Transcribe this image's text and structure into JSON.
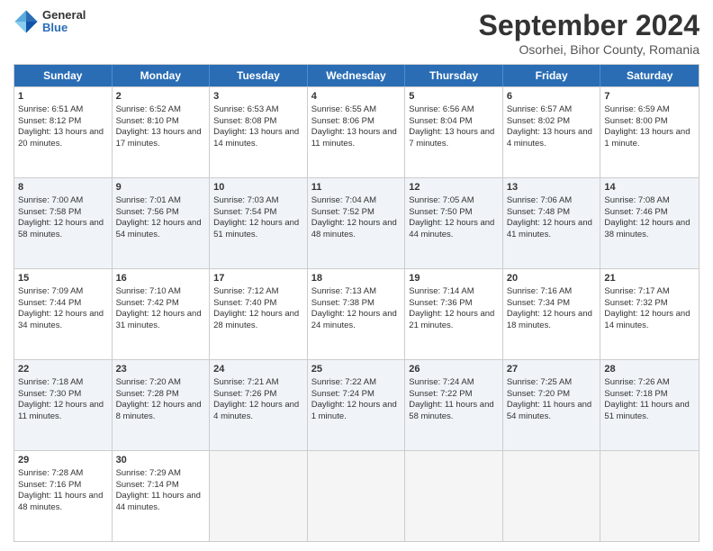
{
  "logo": {
    "general": "General",
    "blue": "Blue"
  },
  "title": "September 2024",
  "location": "Osorhei, Bihor County, Romania",
  "headers": [
    "Sunday",
    "Monday",
    "Tuesday",
    "Wednesday",
    "Thursday",
    "Friday",
    "Saturday"
  ],
  "rows": [
    [
      {
        "day": "1",
        "sunrise": "Sunrise: 6:51 AM",
        "sunset": "Sunset: 8:12 PM",
        "daylight": "Daylight: 13 hours and 20 minutes."
      },
      {
        "day": "2",
        "sunrise": "Sunrise: 6:52 AM",
        "sunset": "Sunset: 8:10 PM",
        "daylight": "Daylight: 13 hours and 17 minutes."
      },
      {
        "day": "3",
        "sunrise": "Sunrise: 6:53 AM",
        "sunset": "Sunset: 8:08 PM",
        "daylight": "Daylight: 13 hours and 14 minutes."
      },
      {
        "day": "4",
        "sunrise": "Sunrise: 6:55 AM",
        "sunset": "Sunset: 8:06 PM",
        "daylight": "Daylight: 13 hours and 11 minutes."
      },
      {
        "day": "5",
        "sunrise": "Sunrise: 6:56 AM",
        "sunset": "Sunset: 8:04 PM",
        "daylight": "Daylight: 13 hours and 7 minutes."
      },
      {
        "day": "6",
        "sunrise": "Sunrise: 6:57 AM",
        "sunset": "Sunset: 8:02 PM",
        "daylight": "Daylight: 13 hours and 4 minutes."
      },
      {
        "day": "7",
        "sunrise": "Sunrise: 6:59 AM",
        "sunset": "Sunset: 8:00 PM",
        "daylight": "Daylight: 13 hours and 1 minute."
      }
    ],
    [
      {
        "day": "8",
        "sunrise": "Sunrise: 7:00 AM",
        "sunset": "Sunset: 7:58 PM",
        "daylight": "Daylight: 12 hours and 58 minutes."
      },
      {
        "day": "9",
        "sunrise": "Sunrise: 7:01 AM",
        "sunset": "Sunset: 7:56 PM",
        "daylight": "Daylight: 12 hours and 54 minutes."
      },
      {
        "day": "10",
        "sunrise": "Sunrise: 7:03 AM",
        "sunset": "Sunset: 7:54 PM",
        "daylight": "Daylight: 12 hours and 51 minutes."
      },
      {
        "day": "11",
        "sunrise": "Sunrise: 7:04 AM",
        "sunset": "Sunset: 7:52 PM",
        "daylight": "Daylight: 12 hours and 48 minutes."
      },
      {
        "day": "12",
        "sunrise": "Sunrise: 7:05 AM",
        "sunset": "Sunset: 7:50 PM",
        "daylight": "Daylight: 12 hours and 44 minutes."
      },
      {
        "day": "13",
        "sunrise": "Sunrise: 7:06 AM",
        "sunset": "Sunset: 7:48 PM",
        "daylight": "Daylight: 12 hours and 41 minutes."
      },
      {
        "day": "14",
        "sunrise": "Sunrise: 7:08 AM",
        "sunset": "Sunset: 7:46 PM",
        "daylight": "Daylight: 12 hours and 38 minutes."
      }
    ],
    [
      {
        "day": "15",
        "sunrise": "Sunrise: 7:09 AM",
        "sunset": "Sunset: 7:44 PM",
        "daylight": "Daylight: 12 hours and 34 minutes."
      },
      {
        "day": "16",
        "sunrise": "Sunrise: 7:10 AM",
        "sunset": "Sunset: 7:42 PM",
        "daylight": "Daylight: 12 hours and 31 minutes."
      },
      {
        "day": "17",
        "sunrise": "Sunrise: 7:12 AM",
        "sunset": "Sunset: 7:40 PM",
        "daylight": "Daylight: 12 hours and 28 minutes."
      },
      {
        "day": "18",
        "sunrise": "Sunrise: 7:13 AM",
        "sunset": "Sunset: 7:38 PM",
        "daylight": "Daylight: 12 hours and 24 minutes."
      },
      {
        "day": "19",
        "sunrise": "Sunrise: 7:14 AM",
        "sunset": "Sunset: 7:36 PM",
        "daylight": "Daylight: 12 hours and 21 minutes."
      },
      {
        "day": "20",
        "sunrise": "Sunrise: 7:16 AM",
        "sunset": "Sunset: 7:34 PM",
        "daylight": "Daylight: 12 hours and 18 minutes."
      },
      {
        "day": "21",
        "sunrise": "Sunrise: 7:17 AM",
        "sunset": "Sunset: 7:32 PM",
        "daylight": "Daylight: 12 hours and 14 minutes."
      }
    ],
    [
      {
        "day": "22",
        "sunrise": "Sunrise: 7:18 AM",
        "sunset": "Sunset: 7:30 PM",
        "daylight": "Daylight: 12 hours and 11 minutes."
      },
      {
        "day": "23",
        "sunrise": "Sunrise: 7:20 AM",
        "sunset": "Sunset: 7:28 PM",
        "daylight": "Daylight: 12 hours and 8 minutes."
      },
      {
        "day": "24",
        "sunrise": "Sunrise: 7:21 AM",
        "sunset": "Sunset: 7:26 PM",
        "daylight": "Daylight: 12 hours and 4 minutes."
      },
      {
        "day": "25",
        "sunrise": "Sunrise: 7:22 AM",
        "sunset": "Sunset: 7:24 PM",
        "daylight": "Daylight: 12 hours and 1 minute."
      },
      {
        "day": "26",
        "sunrise": "Sunrise: 7:24 AM",
        "sunset": "Sunset: 7:22 PM",
        "daylight": "Daylight: 11 hours and 58 minutes."
      },
      {
        "day": "27",
        "sunrise": "Sunrise: 7:25 AM",
        "sunset": "Sunset: 7:20 PM",
        "daylight": "Daylight: 11 hours and 54 minutes."
      },
      {
        "day": "28",
        "sunrise": "Sunrise: 7:26 AM",
        "sunset": "Sunset: 7:18 PM",
        "daylight": "Daylight: 11 hours and 51 minutes."
      }
    ],
    [
      {
        "day": "29",
        "sunrise": "Sunrise: 7:28 AM",
        "sunset": "Sunset: 7:16 PM",
        "daylight": "Daylight: 11 hours and 48 minutes."
      },
      {
        "day": "30",
        "sunrise": "Sunrise: 7:29 AM",
        "sunset": "Sunset: 7:14 PM",
        "daylight": "Daylight: 11 hours and 44 minutes."
      },
      null,
      null,
      null,
      null,
      null
    ]
  ]
}
